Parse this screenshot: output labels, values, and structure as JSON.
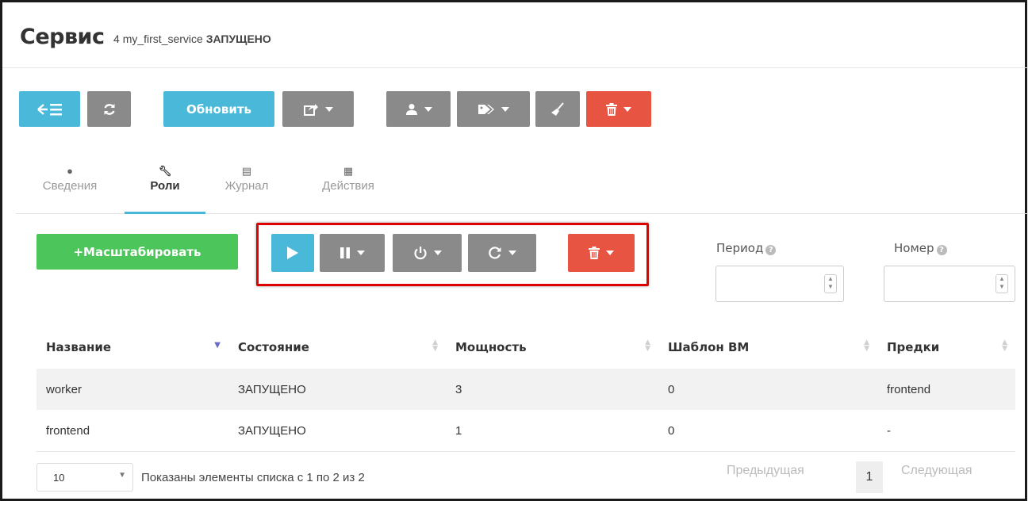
{
  "header": {
    "title": "Сервис",
    "id": "4",
    "name": "my_first_service",
    "state": "ЗАПУЩЕНО"
  },
  "toolbar": {
    "update_label": "Обновить"
  },
  "tabs": [
    {
      "label": "Сведения",
      "icon": "info-circle-icon"
    },
    {
      "label": "Роли",
      "icon": "wrench-icon"
    },
    {
      "label": "Журнал",
      "icon": "file-icon"
    },
    {
      "label": "Действия",
      "icon": "calendar-icon"
    }
  ],
  "roles": {
    "scale_label": "+Масштабировать",
    "period_label": "Период",
    "number_label": "Номер",
    "columns": [
      "Название",
      "Состояние",
      "Мощность",
      "Шаблон ВМ",
      "Предки"
    ],
    "rows": [
      {
        "name": "worker",
        "state": "ЗАПУЩЕНО",
        "cardinality": "3",
        "template": "0",
        "parents": "frontend"
      },
      {
        "name": "frontend",
        "state": "ЗАПУЩЕНО",
        "cardinality": "1",
        "template": "0",
        "parents": "-"
      }
    ]
  },
  "footer": {
    "page_size": "10",
    "info": "Показаны элементы списка с 1 по 2 из 2",
    "prev": "Предыдущая",
    "page": "1",
    "next": "Следующая"
  },
  "colors": {
    "blue": "#4ab9d9",
    "gray": "#8a8a8a",
    "red": "#e75441",
    "green": "#4cc65a",
    "highlight": "#e00000"
  }
}
